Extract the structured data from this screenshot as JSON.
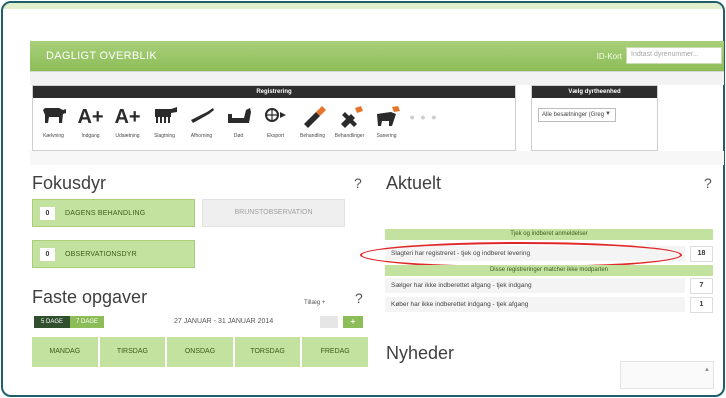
{
  "header": {
    "title": "DAGLIGT OVERBLIK",
    "id_label": "ID-Kort",
    "search_placeholder": "Indtast dyrenummer..."
  },
  "registrering": {
    "title": "Registrering",
    "items": [
      {
        "label": "Kælvning",
        "icon": "cow-icon"
      },
      {
        "label": "Indgang",
        "icon": "animal-in-icon",
        "glyph": "A+"
      },
      {
        "label": "Udsætning",
        "icon": "animal-out-icon",
        "glyph": "A+"
      },
      {
        "label": "Slagtning",
        "icon": "slaughter-icon"
      },
      {
        "label": "Afhorning",
        "icon": "dehorning-icon"
      },
      {
        "label": "Død",
        "icon": "dead-animal-icon"
      },
      {
        "label": "Eksport",
        "icon": "export-icon"
      },
      {
        "label": "Behandling",
        "icon": "syringe-icon"
      },
      {
        "label": "Behandlinger",
        "icon": "treatments-icon"
      },
      {
        "label": "Sanering",
        "icon": "sanitation-icon"
      },
      {
        "label": "",
        "icon": "more-icon",
        "glyph": "• • •"
      }
    ]
  },
  "vaelg": {
    "title": "Vælg dyrtheenhed",
    "selected": "Alle besætninger (Greg"
  },
  "fokusdyr": {
    "title": "Fokusdyr",
    "help": "?",
    "dagens_behandling": {
      "count": "0",
      "label": "DAGENS BEHANDLING"
    },
    "brunstobservation": {
      "label": "BRUNSTOBSERVATION"
    },
    "observationsdyr": {
      "count": "0",
      "label": "OBSERVATIONSDYR"
    }
  },
  "faste": {
    "title": "Faste opgaver",
    "help": "?",
    "tillag": "Tillæg +",
    "tab_5": "5 DAGE",
    "tab_7": "7 DAGE",
    "date_range": "27 JANUAR - 31 JANUAR 2014",
    "next": "+",
    "days": [
      "MANDAG",
      "TIRSDAG",
      "ONSDAG",
      "TORSDAG",
      "FREDAG"
    ]
  },
  "aktuelt": {
    "title": "Aktuelt",
    "help": "?",
    "section1": "Tjek og indberet anmeldelser",
    "rows1": [
      {
        "text": "Slagteri har registreret - tjek og indberet levering",
        "count": "18"
      }
    ],
    "section2": "Disse registreringer matcher ikke modparten",
    "rows2": [
      {
        "text": "Sælger har ikke indberettet afgang - tjek indgang",
        "count": "7"
      },
      {
        "text": "Køber har ikke indberettet indgang - tjek afgang",
        "count": "1"
      }
    ]
  },
  "nyheder": {
    "title": "Nyheder"
  },
  "colors": {
    "brand_green": "#8dbd58",
    "light_green": "#c4e29f",
    "dark": "#2d2d2d",
    "highlight": "#e0282a",
    "frame": "#1f5f6b"
  }
}
